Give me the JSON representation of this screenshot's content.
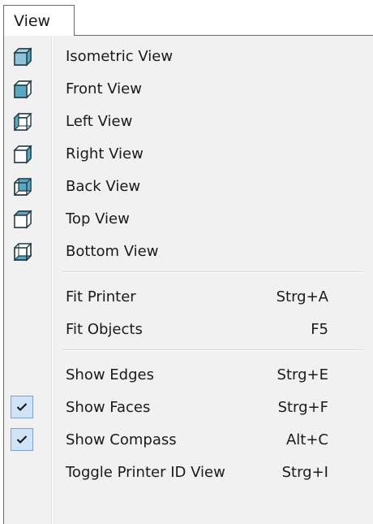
{
  "menu": {
    "title": "View"
  },
  "items": [
    {
      "label": "Isometric View",
      "shortcut": "",
      "icon": "isometric-view-icon"
    },
    {
      "label": "Front View",
      "shortcut": "",
      "icon": "front-view-icon"
    },
    {
      "label": "Left View",
      "shortcut": "",
      "icon": "left-view-icon"
    },
    {
      "label": "Right View",
      "shortcut": "",
      "icon": "right-view-icon"
    },
    {
      "label": "Back View",
      "shortcut": "",
      "icon": "back-view-icon"
    },
    {
      "label": "Top View",
      "shortcut": "",
      "icon": "top-view-icon"
    },
    {
      "label": "Bottom View",
      "shortcut": "",
      "icon": "bottom-view-icon"
    },
    {
      "label": "Fit Printer",
      "shortcut": "Strg+A"
    },
    {
      "label": "Fit Objects",
      "shortcut": "F5"
    },
    {
      "label": "Show Edges",
      "shortcut": "Strg+E",
      "checked": false
    },
    {
      "label": "Show Faces",
      "shortcut": "Strg+F",
      "checked": true
    },
    {
      "label": "Show Compass",
      "shortcut": "Alt+C",
      "checked": true
    },
    {
      "label": "Toggle Printer ID View",
      "shortcut": "Strg+I"
    }
  ],
  "colors": {
    "cube_fill": "#5aa7c2",
    "cube_stroke": "#1f3a44",
    "check_bg": "#cfe5f7",
    "check_border": "#7da2ce"
  }
}
